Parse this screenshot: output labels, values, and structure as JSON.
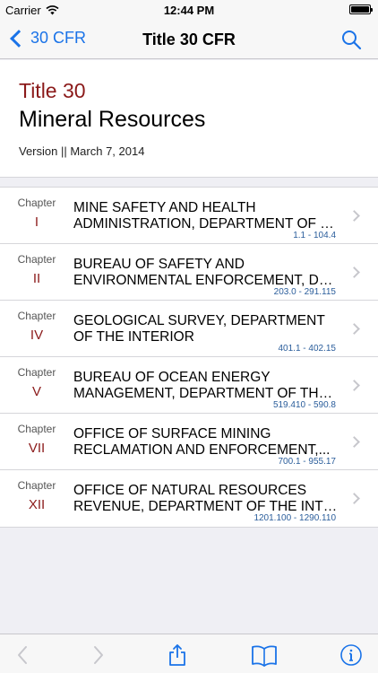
{
  "status_bar": {
    "carrier": "Carrier",
    "time": "12:44 PM"
  },
  "nav": {
    "back_label": "30 CFR",
    "title": "Title 30 CFR"
  },
  "header": {
    "title_number": "Title 30",
    "title_name": "Mineral Resources",
    "version": "Version || March 7, 2014"
  },
  "chapters": [
    {
      "label": "Chapter",
      "number": "I",
      "line1": "MINE SAFETY AND HEALTH",
      "line2": "ADMINISTRATION, DEPARTMENT OF L...",
      "range": "1.1 - 104.4"
    },
    {
      "label": "Chapter",
      "number": "II",
      "line1": "BUREAU OF SAFETY AND",
      "line2": "ENVIRONMENTAL ENFORCEMENT, DE...",
      "range": "203.0 - 291.115"
    },
    {
      "label": "Chapter",
      "number": "IV",
      "line1": "GEOLOGICAL SURVEY, DEPARTMENT",
      "line2": "OF THE INTERIOR",
      "range": "401.1 - 402.15"
    },
    {
      "label": "Chapter",
      "number": "V",
      "line1": "BUREAU OF OCEAN ENERGY",
      "line2": "MANAGEMENT, DEPARTMENT OF THE...",
      "range": "519.410 - 590.8"
    },
    {
      "label": "Chapter",
      "number": "VII",
      "line1": "OFFICE OF SURFACE MINING",
      "line2": "RECLAMATION AND ENFORCEMENT,...",
      "range": "700.1 - 955.17"
    },
    {
      "label": "Chapter",
      "number": "XII",
      "line1": "OFFICE OF NATURAL RESOURCES",
      "line2": "REVENUE, DEPARTMENT OF THE INTE...",
      "range": "1201.100 - 1290.110"
    }
  ],
  "colors": {
    "accent": "#1a73e8",
    "title_red": "#8b1a1a",
    "range_blue": "#2a5d9b"
  },
  "icons": {
    "back": "chevron-left-icon",
    "search": "search-icon",
    "toolbar": [
      "arrow-left-icon",
      "arrow-right-icon",
      "share-icon",
      "book-icon",
      "info-icon"
    ]
  }
}
